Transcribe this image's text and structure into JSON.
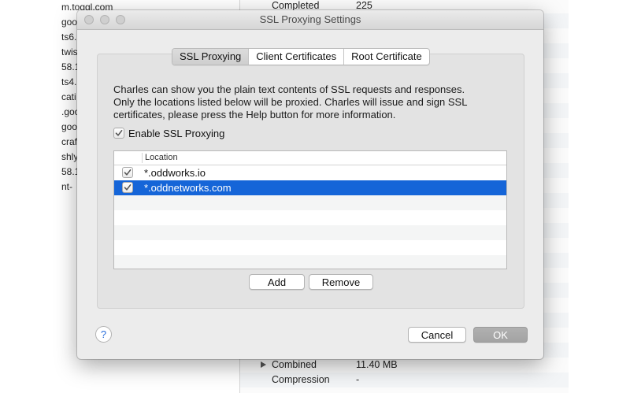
{
  "background_window": {
    "left_items": [
      "m.toggl.com",
      "goo",
      "ts6.",
      "twis",
      "58.1",
      "ts4.",
      "cati",
      ".goo",
      "goo",
      "craf",
      "shly",
      "58.1",
      "nt-"
    ],
    "top_row": {
      "label": "Completed",
      "value": "225"
    },
    "bottom_rows": [
      {
        "label": "Combined",
        "value": "11.40 MB",
        "expandable": true
      },
      {
        "label": "Compression",
        "value": "-",
        "expandable": false
      }
    ]
  },
  "dialog": {
    "title": "SSL Proxying Settings",
    "tabs": [
      {
        "label": "SSL Proxying",
        "active": true
      },
      {
        "label": "Client Certificates",
        "active": false
      },
      {
        "label": "Root Certificate",
        "active": false
      }
    ],
    "description_lines": [
      "Charles can show you the plain text contents of SSL requests and responses.",
      "Only the locations listed below will be proxied. Charles will issue and sign SSL",
      "certificates, please press the Help button for more information."
    ],
    "enable_ssl": {
      "label": "Enable SSL Proxying",
      "checked": true
    },
    "table": {
      "column_header": "Location",
      "rows": [
        {
          "location": "*.oddworks.io",
          "checked": true,
          "selected": false
        },
        {
          "location": "*.oddnetworks.com",
          "checked": true,
          "selected": true
        }
      ]
    },
    "buttons": {
      "add": "Add",
      "remove": "Remove",
      "help": "?",
      "cancel": "Cancel",
      "ok": "OK"
    }
  },
  "colors": {
    "selection": "#1565d8",
    "dialog_bg": "#ececec",
    "help_accent": "#2a6fdb"
  },
  "icons": [
    "checkmark-icon",
    "help-icon",
    "disclosure-triangle-icon"
  ]
}
